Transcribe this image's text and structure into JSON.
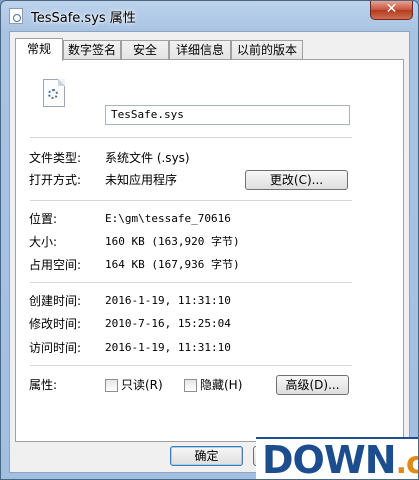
{
  "window": {
    "title": "TesSafe.sys 属性",
    "close_label": "✕"
  },
  "tabs": [
    {
      "label": "常规",
      "active": true
    },
    {
      "label": "数字签名",
      "active": false
    },
    {
      "label": "安全",
      "active": false
    },
    {
      "label": "详细信息",
      "active": false
    },
    {
      "label": "以前的版本",
      "active": false
    }
  ],
  "file": {
    "name": "TesSafe.sys",
    "icon": "system-file-icon"
  },
  "props": {
    "type_label": "文件类型:",
    "type_value": "系统文件 (.sys)",
    "opens_label": "打开方式:",
    "opens_value": "未知应用程序",
    "change_button": "更改(C)...",
    "location_label": "位置:",
    "location_value": "E:\\gm\\tessafe_70616",
    "size_label": "大小:",
    "size_value": "160 KB (163,920 字节)",
    "disk_label": "占用空间:",
    "disk_value": "164 KB (167,936 字节)",
    "created_label": "创建时间:",
    "created_value": "2016-1-19, 11:31:10",
    "modified_label": "修改时间:",
    "modified_value": "2010-7-16, 15:25:04",
    "accessed_label": "访问时间:",
    "accessed_value": "2016-1-19, 11:31:10",
    "attr_label": "属性:",
    "readonly_label": "只读(R)",
    "hidden_label": "隐藏(H)",
    "advanced_button": "高级(D)..."
  },
  "footer": {
    "ok_button": "确定"
  },
  "watermark": {
    "main": "DOWN",
    "suffix": ".cc"
  },
  "colors": {
    "accent": "#1b4d8f",
    "close": "#c7523d",
    "watermark_suffix": "#e08a18"
  }
}
